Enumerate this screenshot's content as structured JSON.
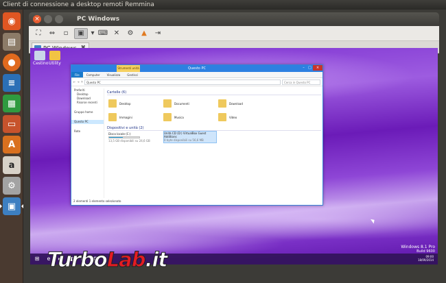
{
  "os": {
    "window_title": "Client di connessione a desktop remoti Remmina"
  },
  "launcher": {
    "items": [
      {
        "name": "ubuntu-dash",
        "icon": "ubuntu-logo-icon",
        "color": "#e05622"
      },
      {
        "name": "files",
        "icon": "files-icon",
        "color": "#8c7b68"
      },
      {
        "name": "firefox",
        "icon": "firefox-icon",
        "color": "#e06a1e"
      },
      {
        "name": "writer",
        "icon": "libreoffice-writer-icon",
        "color": "#2b6fb6"
      },
      {
        "name": "calc",
        "icon": "libreoffice-calc-icon",
        "color": "#2f9a3f"
      },
      {
        "name": "impress",
        "icon": "libreoffice-impress-icon",
        "color": "#c7532c"
      },
      {
        "name": "software-center",
        "icon": "software-center-icon",
        "color": "#d9701f"
      },
      {
        "name": "amazon",
        "icon": "amazon-icon",
        "color": "#d8d2c8"
      },
      {
        "name": "settings",
        "icon": "settings-icon",
        "color": "#a3a3a3"
      },
      {
        "name": "remmina",
        "icon": "remmina-icon",
        "color": "#3d7fc1"
      }
    ]
  },
  "remmina": {
    "title": "PC Windows",
    "close_glyph": "×",
    "tab_label": "PC Windows",
    "tab_close": "✖",
    "toolbar": [
      "fullscreen-icon",
      "fit-window-icon",
      "scale-icon",
      "keyboard-grab-icon",
      "preferences-icon",
      "tools-icon",
      "screenshot-icon",
      "minimize-icon",
      "disconnect-icon"
    ]
  },
  "vm_desktop": {
    "icons": [
      {
        "label": "Cestino"
      },
      {
        "label": "Utility"
      }
    ],
    "watermark": [
      "Windows 8.1 Pro",
      "Build 9600"
    ],
    "clock": [
      "09:00",
      "18/09/2014"
    ],
    "explorer": {
      "title": "Questo PC",
      "context_tab": "Strumenti unità",
      "ribbon_tabs": [
        "File",
        "Computer",
        "Visualizza",
        "Gestisci"
      ],
      "path": "Questo PC",
      "search_placeholder": "Cerca in Questo PC",
      "nav": [
        "Preferiti",
        "Desktop",
        "Download",
        "Risorse recenti",
        "Gruppo home",
        "Questo PC",
        "Rete"
      ],
      "folders_header": "Cartelle (6)",
      "folders": [
        "Desktop",
        "Documenti",
        "Download",
        "Immagini",
        "Musica",
        "Video"
      ],
      "devices_header": "Dispositivi e unità (2)",
      "drives": [
        {
          "name": "Disco locale (C:)",
          "free": "13,5 GB disponibili su 24,6 GB",
          "used_fraction": 0.45
        },
        {
          "name": "Unità CD (D:) VirtualBox Guest Additions",
          "free": "0 byte disponibili su 56,6 MB",
          "used_fraction": 1.0
        }
      ],
      "status": "2 elementi   1 elemento selezionato"
    }
  },
  "watermark": {
    "brand_1": "Turbo",
    "brand_2": "Lab",
    "brand_3": ".it"
  }
}
